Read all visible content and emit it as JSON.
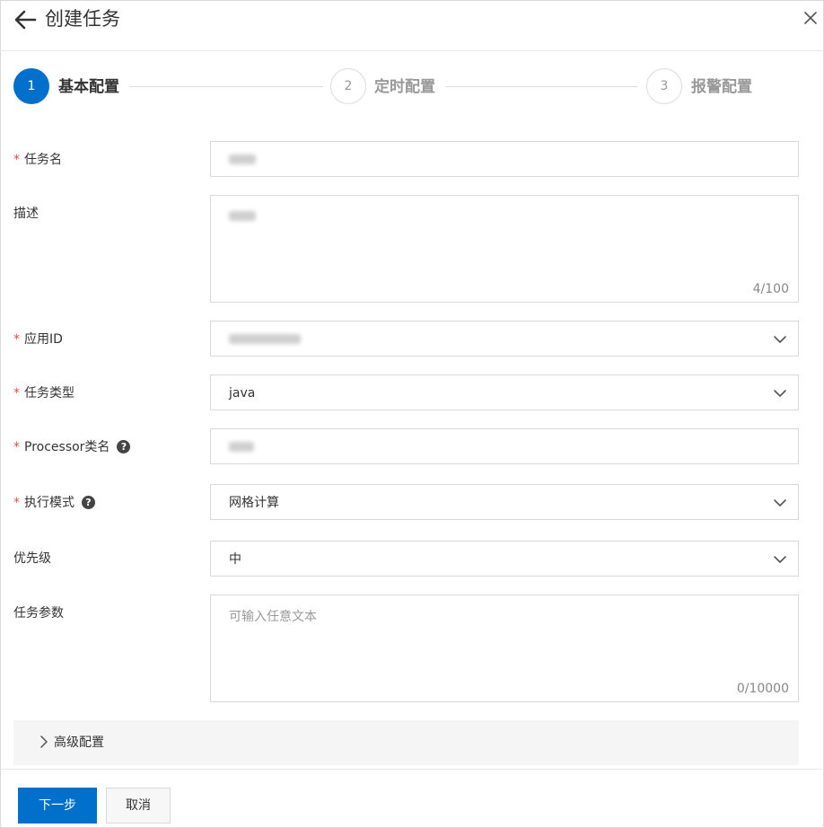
{
  "header": {
    "title": "创建任务",
    "back_icon": "arrow-left-icon",
    "close_icon": "close-icon"
  },
  "steps": [
    {
      "number": "1",
      "label": "基本配置",
      "active": true
    },
    {
      "number": "2",
      "label": "定时配置",
      "active": false
    },
    {
      "number": "3",
      "label": "报警配置",
      "active": false
    }
  ],
  "form": {
    "task_name": {
      "label": "任务名",
      "required": true
    },
    "description": {
      "label": "描述",
      "counter": "4/100"
    },
    "app_id": {
      "label": "应用ID",
      "required": true
    },
    "task_type": {
      "label": "任务类型",
      "required": true,
      "value": "java"
    },
    "processor": {
      "label": "Processor类名",
      "required": true,
      "help": "?"
    },
    "exec_mode": {
      "label": "执行模式",
      "required": true,
      "help": "?",
      "value": "网格计算"
    },
    "priority": {
      "label": "优先级",
      "value": "中"
    },
    "params": {
      "label": "任务参数",
      "placeholder": "可输入任意文本",
      "counter": "0/10000"
    }
  },
  "advanced": {
    "label": "高级配置"
  },
  "footer": {
    "next_label": "下一步",
    "cancel_label": "取消"
  },
  "colors": {
    "primary": "#0070cc",
    "required": "#e84c3d"
  }
}
